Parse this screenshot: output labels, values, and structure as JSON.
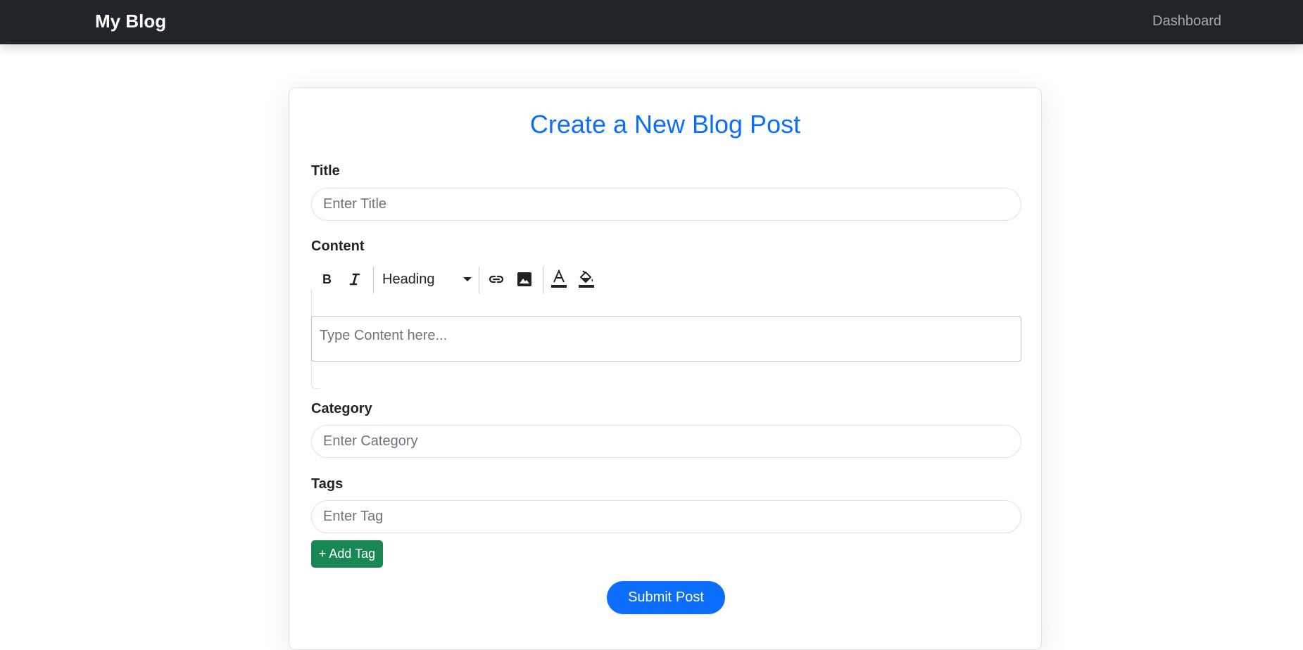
{
  "navbar": {
    "brand": "My Blog",
    "link": "Dashboard"
  },
  "form": {
    "heading": "Create a New Blog Post",
    "title_label": "Title",
    "title_placeholder": "Enter Title",
    "content_label": "Content",
    "toolbar": {
      "heading_option": "Heading",
      "icons": [
        "bold-icon",
        "italic-icon",
        "link-icon",
        "image-icon",
        "text-color-icon",
        "background-color-icon"
      ]
    },
    "content_placeholder": "Type Content here...",
    "category_label": "Category",
    "category_placeholder": "Enter Category",
    "tags_label": "Tags",
    "tag_placeholder": "Enter Tag",
    "add_tag_label": "+ Add Tag",
    "submit_label": "Submit Post"
  },
  "colors": {
    "navbar_bg": "#212529",
    "primary": "#0d6efd",
    "success": "#198754"
  }
}
